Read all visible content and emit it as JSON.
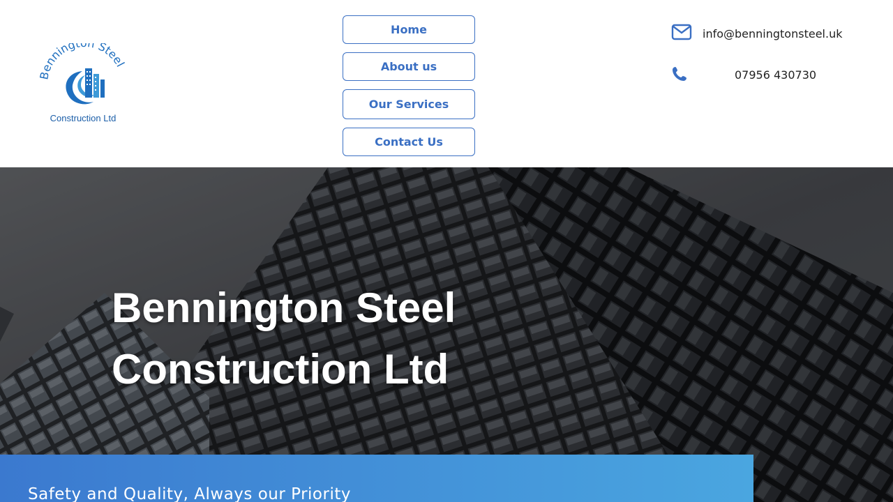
{
  "logo": {
    "arc_text": "Bennington Steel",
    "sub_text": "Construction Ltd"
  },
  "nav": {
    "items": [
      {
        "label": "Home"
      },
      {
        "label": "About us"
      },
      {
        "label": "Our Services"
      },
      {
        "label": "Contact Us"
      }
    ]
  },
  "contact": {
    "email": "info@benningtonsteel.uk",
    "phone": "07956 430730",
    "email_icon": "envelope-icon",
    "phone_icon": "phone-icon"
  },
  "hero": {
    "title_line1": "Bennington Steel",
    "title_line2": "Construction Ltd"
  },
  "banner": {
    "text": "Safety and Quality, Always our Priority"
  },
  "colors": {
    "brand_blue": "#3a6fc3",
    "banner_start": "#3b79cf",
    "banner_end": "#4aa6e0"
  }
}
